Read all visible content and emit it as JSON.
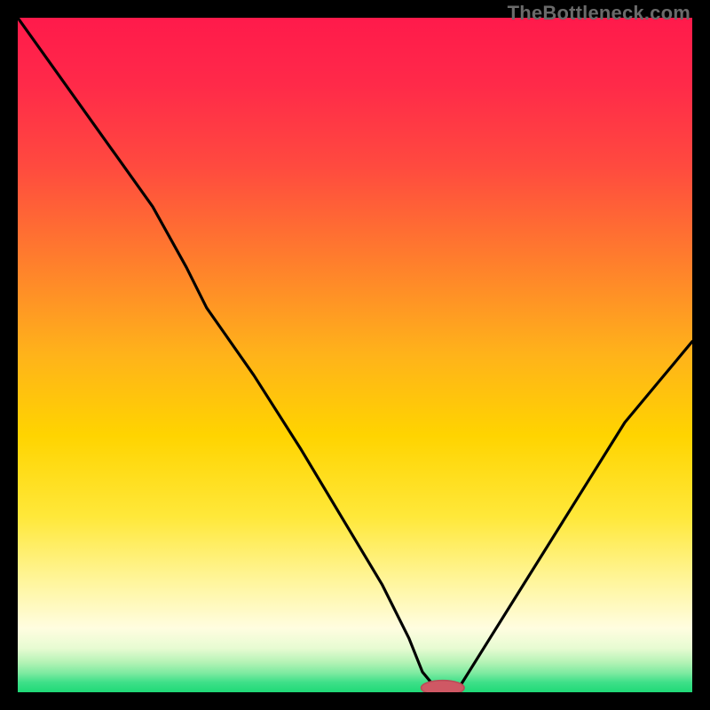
{
  "watermark": {
    "text": "TheBottleneck.com"
  },
  "colors": {
    "bg": "#000000",
    "grad_top": "#ff1744",
    "grad_upper": "#ff5733",
    "grad_mid": "#ffd400",
    "grad_lower": "#fff9c4",
    "grad_green1": "#c1f7c1",
    "grad_green2": "#26e07f",
    "line": "#000000",
    "marker_fill": "#cf5864",
    "marker_stroke": "#b94b57"
  },
  "chart_data": {
    "type": "line",
    "title": "",
    "xlabel": "",
    "ylabel": "",
    "xlim": [
      0,
      100
    ],
    "ylim": [
      0,
      100
    ],
    "grid": false,
    "legend": false,
    "annotations": [],
    "x": [
      0,
      5,
      10,
      15,
      20,
      25,
      28,
      35,
      42,
      48,
      54,
      58,
      60,
      62.5,
      65,
      70,
      75,
      80,
      85,
      90,
      95,
      100
    ],
    "bottleneck_pct": [
      100,
      93,
      86,
      79,
      72,
      63,
      57,
      47,
      36,
      26,
      16,
      8,
      3,
      0,
      0,
      8,
      16,
      24,
      32,
      40,
      46,
      52
    ],
    "optimal_x": 63,
    "marker": {
      "x": 63,
      "y": 0,
      "rx": 3.2,
      "ry": 1.1
    },
    "notes": "Values estimated from pixel geometry; y is percent bottleneck (0 = no bottleneck at optimum)."
  }
}
